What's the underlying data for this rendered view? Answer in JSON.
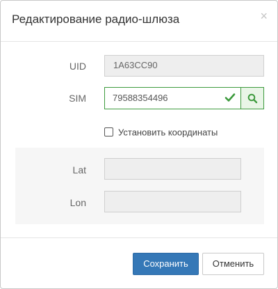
{
  "dialog": {
    "title": "Редактирование радио-шлюза",
    "close_glyph": "×",
    "close_icon": "close-icon"
  },
  "form": {
    "uid": {
      "label": "UID",
      "value": "1A63CC90"
    },
    "sim": {
      "label": "SIM",
      "value": "79588354496",
      "valid_icon": "check-icon",
      "search_icon": "search-icon"
    },
    "set_coordinates": {
      "label": "Установить координаты",
      "checked": false
    },
    "lat": {
      "label": "Lat",
      "value": ""
    },
    "lon": {
      "label": "Lon",
      "value": ""
    }
  },
  "footer": {
    "save_label": "Сохранить",
    "cancel_label": "Отменить"
  },
  "colors": {
    "primary": "#3578b7",
    "success": "#3c9a3c",
    "panel_bg": "#f6f6f6"
  }
}
